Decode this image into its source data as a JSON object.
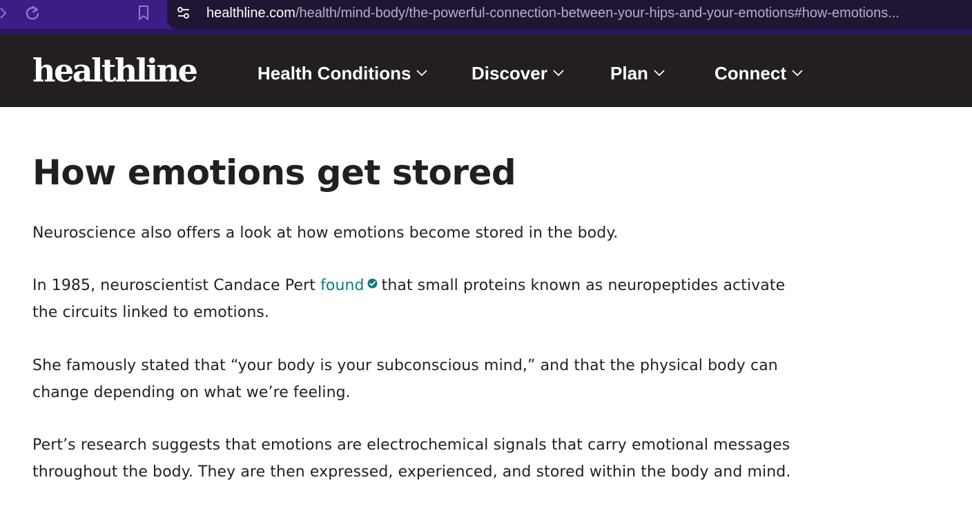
{
  "browser": {
    "url_domain": "healthline.com",
    "url_path": "/health/mind-body/the-powerful-connection-between-your-hips-and-your-emotions#how-emotions..."
  },
  "header": {
    "logo": "healthline",
    "nav": [
      {
        "label": "Health Conditions"
      },
      {
        "label": "Discover"
      },
      {
        "label": "Plan"
      },
      {
        "label": "Connect"
      }
    ]
  },
  "article": {
    "heading": "How emotions get stored",
    "p1": "Neuroscience also offers a look at how emotions become stored in the body.",
    "p2_before": "In 1985, neuroscientist Candace Pert ",
    "p2_link": "found",
    "p2_after": "that small proteins known as neuropeptides activate the circuits linked to emotions.",
    "p3": "She famously stated that “your body is your subconscious mind,” and that the physical body can change depending on what we’re feeling.",
    "p4": "Pert’s research suggests that emotions are electrochemical signals that carry emotional messages throughout the body. They are then expressed, experienced, and stored within the body and mind."
  },
  "colors": {
    "browser_bar": "#3a1e86",
    "header_bg": "#231f20",
    "link": "#0d7c7c",
    "text": "#231f20"
  },
  "icons": [
    "forward-icon",
    "reload-icon",
    "bookmark-icon",
    "site-info-icon",
    "chevron-down-icon",
    "verified-check-icon"
  ]
}
